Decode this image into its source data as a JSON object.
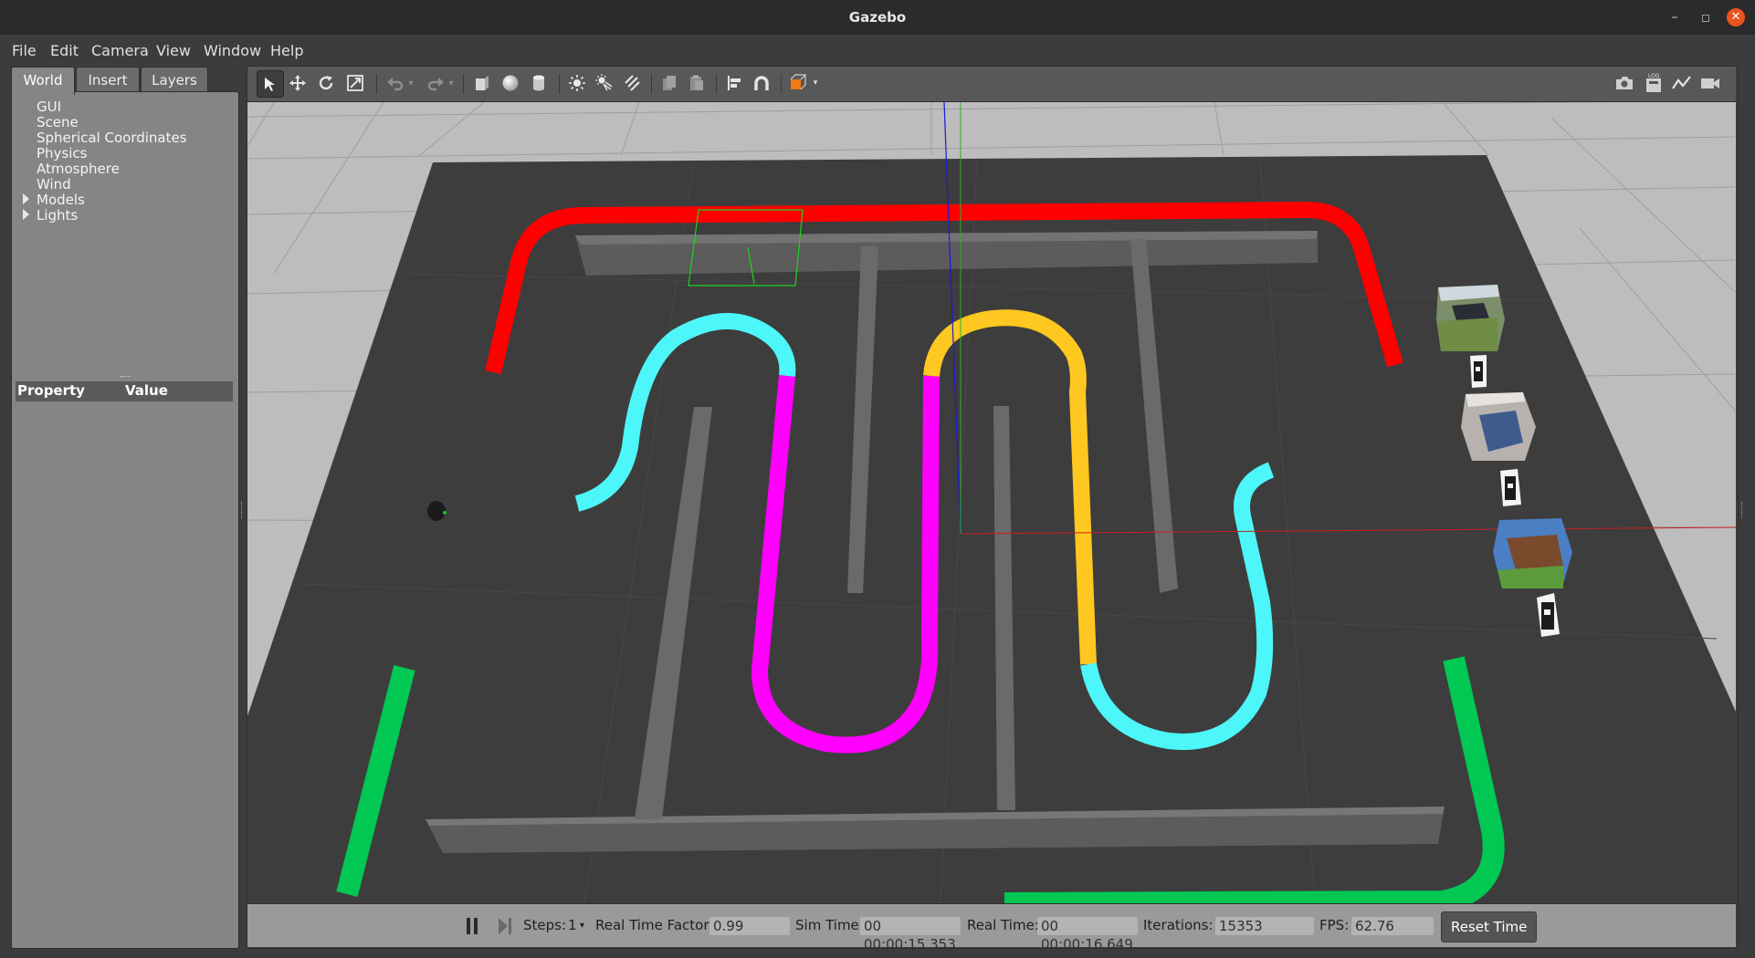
{
  "window": {
    "title": "Gazebo",
    "minimize": "–",
    "maximize": "◻",
    "close": "✕"
  },
  "menu": [
    "File",
    "Edit",
    "Camera",
    "View",
    "Window",
    "Help"
  ],
  "tabs": [
    "World",
    "Insert",
    "Layers"
  ],
  "tree": {
    "items": [
      "GUI",
      "Scene",
      "Spherical Coordinates",
      "Physics",
      "Atmosphere",
      "Wind"
    ],
    "expandable": [
      "Models",
      "Lights"
    ]
  },
  "properties": {
    "col_property": "Property",
    "col_value": "Value"
  },
  "toolbar": {
    "tools": [
      "select-tool",
      "translate-tool",
      "rotate-tool",
      "scale-tool",
      "undo",
      "redo",
      "box-shape",
      "sphere-shape",
      "cylinder-shape",
      "point-light",
      "spot-light",
      "directional-light",
      "copy",
      "paste",
      "align",
      "snap",
      "change-view"
    ],
    "right_tools": [
      "screenshot",
      "log",
      "plot",
      "video"
    ]
  },
  "status": {
    "steps_label": "Steps:",
    "steps_value": "1",
    "rtf_label": "Real Time Factor:",
    "rtf_value": "0.99",
    "sim_label": "Sim Time:",
    "sim_value": "00 00:00:15.353",
    "real_label": "Real Time:",
    "real_value": "00 00:00:16.649",
    "iter_label": "Iterations:",
    "iter_value": "15353",
    "fps_label": "FPS:",
    "fps_value": "62.76",
    "reset_label": "Reset Time"
  },
  "colors": {
    "track_red": "#ff0000",
    "track_cyan": "#4df6f8",
    "track_magenta": "#ff00ff",
    "track_yellow": "#ffc820",
    "track_green": "#00c853",
    "ground": "#3d3d3d",
    "wall": "#6a6a6a"
  }
}
